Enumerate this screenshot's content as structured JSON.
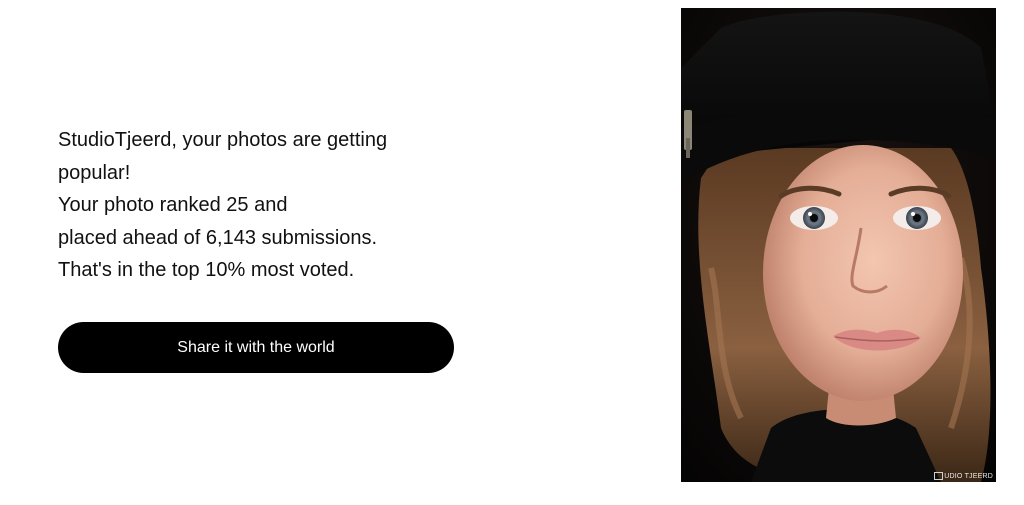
{
  "message": {
    "lines": [
      "StudioTjeerd, your photos are getting",
      "popular!",
      "Your photo ranked 25 and",
      "placed ahead of 6,143 submissions.",
      "That's in the top 10% most voted."
    ]
  },
  "share_button": {
    "label": "Share it with the world"
  },
  "photo": {
    "watermark": "UDIO TJEERD"
  },
  "colors": {
    "button_bg": "#000000",
    "button_text": "#ffffff",
    "text": "#111111",
    "background": "#ffffff"
  }
}
